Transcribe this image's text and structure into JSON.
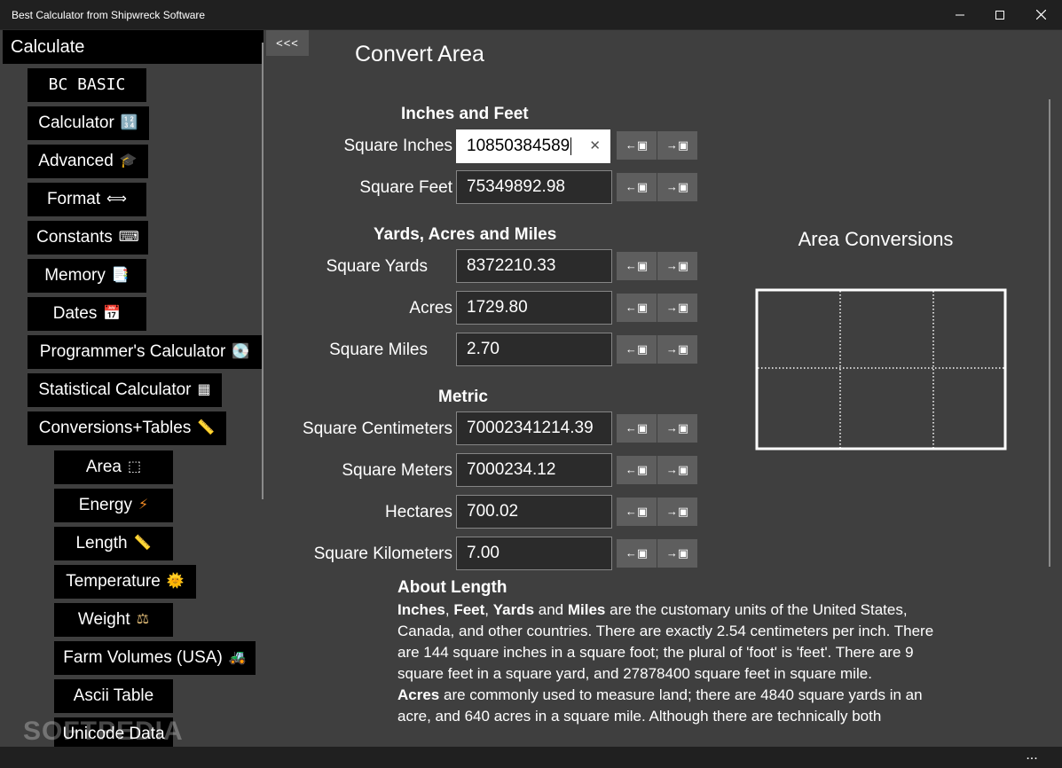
{
  "window": {
    "title": "Best Calculator from Shipwreck Software",
    "minimize": "—",
    "maximize": "☐",
    "close": "✕"
  },
  "sidebar": {
    "header": "Calculate",
    "items": [
      {
        "label": "BC BASIC",
        "icon": ""
      },
      {
        "label": "Calculator",
        "icon": "🔢"
      },
      {
        "label": "Advanced",
        "icon": "🎓"
      },
      {
        "label": "Format",
        "icon": "⟺"
      },
      {
        "label": "Constants",
        "icon": "⌨"
      },
      {
        "label": "Memory",
        "icon": "📑"
      },
      {
        "label": "Dates",
        "icon": "📅"
      },
      {
        "label": "Programmer's Calculator",
        "icon": "💽"
      },
      {
        "label": "Statistical Calculator",
        "icon": "▦"
      },
      {
        "label": "Conversions+Tables",
        "icon": "📏"
      },
      {
        "label": "Area",
        "icon": "⬚"
      },
      {
        "label": "Energy",
        "icon": "⚡"
      },
      {
        "label": "Length",
        "icon": "📏"
      },
      {
        "label": "Temperature",
        "icon": "🌞"
      },
      {
        "label": "Weight",
        "icon": "⚖"
      },
      {
        "label": "Farm Volumes (USA)",
        "icon": "🚜"
      },
      {
        "label": "Ascii Table",
        "icon": ""
      },
      {
        "label": "Unicode Data",
        "icon": ""
      }
    ]
  },
  "content": {
    "collapse": "<<<",
    "title": "Convert Area",
    "sections": [
      {
        "heading": "Inches and Feet"
      },
      {
        "heading": "Yards, Acres and Miles"
      },
      {
        "heading": "Metric"
      }
    ],
    "rows": [
      {
        "label": "Square Inches",
        "value": "10850384589",
        "to_left": "←▣",
        "to_right": "→▣"
      },
      {
        "label": "Square Feet",
        "value": "75349892.98",
        "to_left": "←▣",
        "to_right": "→▣"
      },
      {
        "label": "Square Yards",
        "value": "8372210.33",
        "to_left": "←▣",
        "to_right": "→▣"
      },
      {
        "label": "Acres",
        "value": "1729.80",
        "to_left": "←▣",
        "to_right": "→▣"
      },
      {
        "label": "Square Miles",
        "value": "2.70",
        "to_left": "←▣",
        "to_right": "→▣"
      },
      {
        "label": "Square Centimeters",
        "value": "70002341214.39",
        "to_left": "←▣",
        "to_right": "→▣"
      },
      {
        "label": "Square Meters",
        "value": "7000234.12",
        "to_left": "←▣",
        "to_right": "→▣"
      },
      {
        "label": "Hectares",
        "value": "700.02",
        "to_left": "←▣",
        "to_right": "→▣"
      },
      {
        "label": "Square Kilometers",
        "value": "7.00",
        "to_left": "←▣",
        "to_right": "→▣"
      }
    ],
    "clear_glyph": "✕",
    "diagram_title": "Area Conversions",
    "about": {
      "heading": "About Length",
      "p1_b1": "Inches",
      "p1_sep1": ", ",
      "p1_b2": "Feet",
      "p1_sep2": ", ",
      "p1_b3": "Yards",
      "p1_sep3": " and ",
      "p1_b4": "Miles",
      "p1_text": " are the customary units of the United States, Canada, and other countries. There are exactly 2.54 centimeters per inch. There are 144 square inches in a square foot; the plural of 'foot' is 'feet'. There are 9 square feet in a square yard, and 27878400 square feet in square mile.",
      "p2_b1": "Acres",
      "p2_text": " are commonly used to measure land; there are 4840 square yards in an acre, and 640 acres in a square mile. Although there are technically both"
    }
  },
  "bottom": {
    "more": "..."
  },
  "watermark": "SOFTPEDIA"
}
